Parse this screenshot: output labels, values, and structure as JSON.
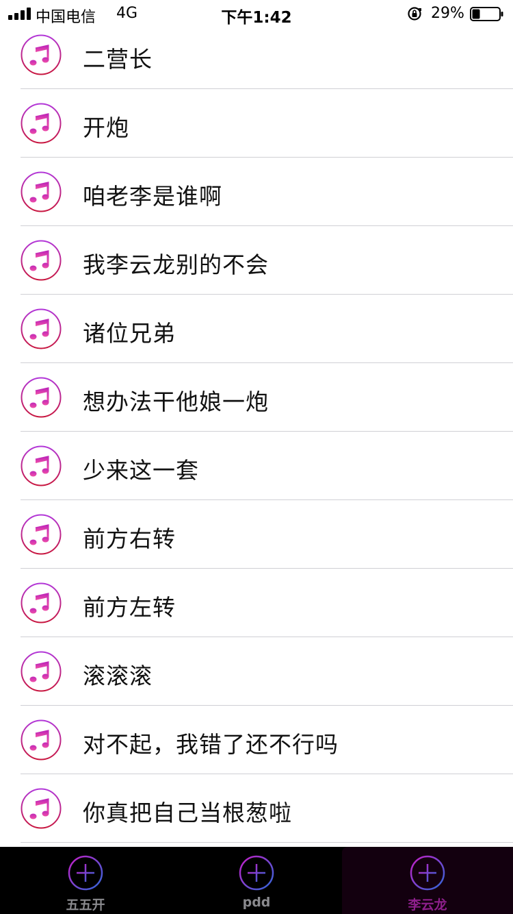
{
  "status_bar": {
    "carrier": "中国电信",
    "network": "4G",
    "time": "下午1:42",
    "battery": "29%",
    "battery_level": 0.29
  },
  "songs": [
    {
      "title": "二营长",
      "icon": "music-note-icon"
    },
    {
      "title": "开炮",
      "icon": "music-note-icon"
    },
    {
      "title": "咱老李是谁啊",
      "icon": "music-note-icon"
    },
    {
      "title": "我李云龙别的不会",
      "icon": "music-note-icon"
    },
    {
      "title": "诸位兄弟",
      "icon": "music-note-icon"
    },
    {
      "title": "想办法干他娘一炮",
      "icon": "music-note-icon"
    },
    {
      "title": "少来这一套",
      "icon": "music-note-icon"
    },
    {
      "title": "前方右转",
      "icon": "music-note-icon"
    },
    {
      "title": "前方左转",
      "icon": "music-note-icon"
    },
    {
      "title": "滚滚滚",
      "icon": "music-note-icon"
    },
    {
      "title": "对不起，我错了还不行吗",
      "icon": "music-note-icon"
    },
    {
      "title": "你真把自己当根葱啦",
      "icon": "music-note-icon"
    }
  ],
  "tabs": [
    {
      "label": "五五开",
      "icon": "plus-circle-icon",
      "active": false
    },
    {
      "label": "pdd",
      "icon": "plus-circle-icon",
      "active": false
    },
    {
      "label": "李云龙",
      "icon": "plus-circle-icon",
      "active": true
    }
  ],
  "colors": {
    "accent": "#8e1f8c",
    "icon_gradient_top": "#d63bd6",
    "icon_gradient_bottom": "#c8163f",
    "tab_bar_bg": "#000000",
    "divider": "#cfcfd4"
  }
}
